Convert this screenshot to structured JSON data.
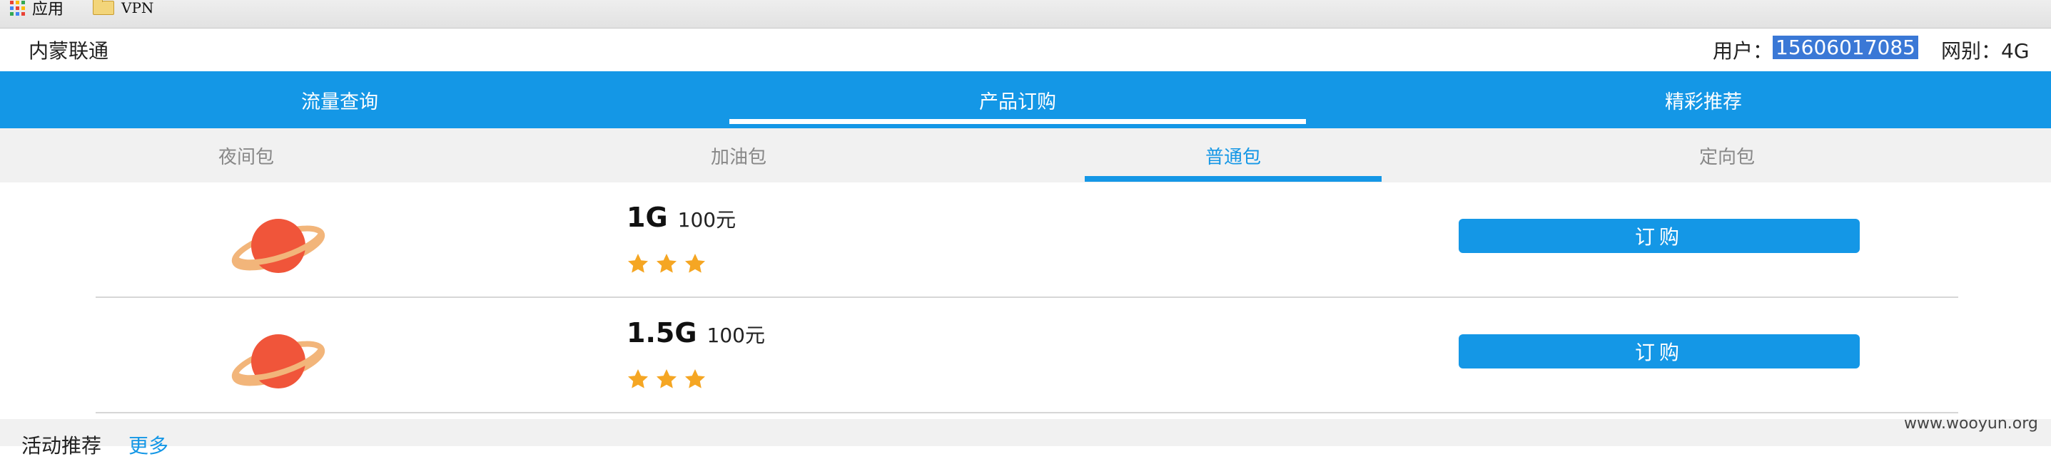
{
  "bookmarks": {
    "apps_label": "应用",
    "folder_label": "VPN"
  },
  "header": {
    "brand": "内蒙联通",
    "user_label": "用户：",
    "user_phone": "15606017085",
    "network_label": "网别：4G"
  },
  "main_nav": {
    "tabs": [
      {
        "label": "流量查询"
      },
      {
        "label": "产品订购"
      },
      {
        "label": "精彩推荐"
      }
    ],
    "active_index": 1
  },
  "sub_nav": {
    "tabs": [
      {
        "label": "夜间包"
      },
      {
        "label": "加油包"
      },
      {
        "label": "普通包"
      },
      {
        "label": "定向包"
      }
    ],
    "active_index": 2
  },
  "packages": [
    {
      "size": "1G",
      "price": "100元",
      "rating": 3,
      "button_label": "订购",
      "icon": "planet-icon"
    },
    {
      "size": "1.5G",
      "price": "100元",
      "rating": 3,
      "button_label": "订购",
      "icon": "planet-icon"
    }
  ],
  "footer": {
    "activity_label": "活动推荐",
    "more_label": "更多"
  },
  "watermark": "www.wooyun.org",
  "colors": {
    "accent": "#1497e6",
    "planet": "#f0553a",
    "ring": "#f2b57a",
    "star": "#f5a623"
  }
}
